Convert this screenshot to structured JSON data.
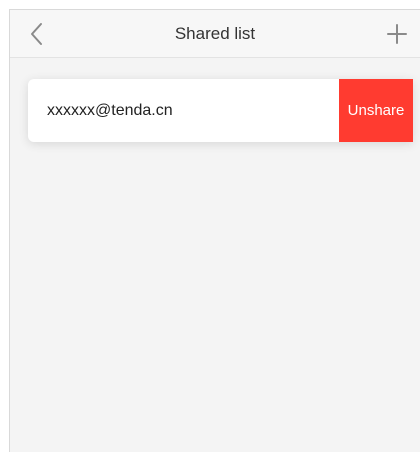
{
  "header": {
    "title": "Shared list",
    "back_icon": "chevron-left-icon",
    "add_icon": "plus-icon"
  },
  "shared_list": {
    "items": [
      {
        "email": "xxxxxx@tenda.cn",
        "action_label": "Unshare"
      }
    ]
  },
  "colors": {
    "unshare_background": "#ff3b30",
    "unshare_text": "#ffffff",
    "icon_color": "#8a8a8a"
  }
}
